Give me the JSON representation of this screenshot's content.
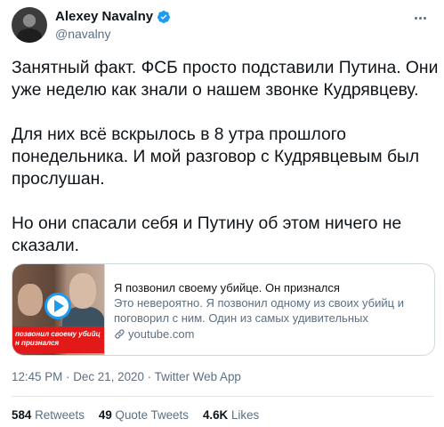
{
  "author": {
    "name": "Alexey Navalny",
    "handle": "@navalny",
    "verified_color": "#1d9bf0"
  },
  "tweet": {
    "paragraphs": [
      "Занятный факт. ФСБ просто подставили Путина. Они\nуже неделю как знали о нашем звонке Кудрявцеву.",
      "Для них всё вскрылось в 8 утра прошлого\nпонедельника. И мой разговор с Кудрявцевым был\nпрослушан.",
      "Но они спасали себя и Путину об этом ничего не\nсказали."
    ]
  },
  "card": {
    "thumbnail_caption": "позвонил своему убийц\nн признался",
    "title": "Я позвонил своему убийце. Он признался",
    "description": "Это невероятно. Я позвонил одному из своих убийц и поговорил с ним. Один из самых удивительных разговоров...",
    "domain": "youtube.com",
    "icons": {
      "play": "play-icon",
      "link": "link-icon"
    }
  },
  "meta": {
    "time": "12:45 PM",
    "separator": "·",
    "date": "Dec 21, 2020",
    "source": "Twitter Web App"
  },
  "stats": {
    "retweets_count": "584",
    "retweets_label": "Retweets",
    "quotes_count": "49",
    "quotes_label": "Quote Tweets",
    "likes_count": "4.6K",
    "likes_label": "Likes"
  },
  "icons": {
    "verified": "verified-badge-icon",
    "more": "more-icon"
  }
}
